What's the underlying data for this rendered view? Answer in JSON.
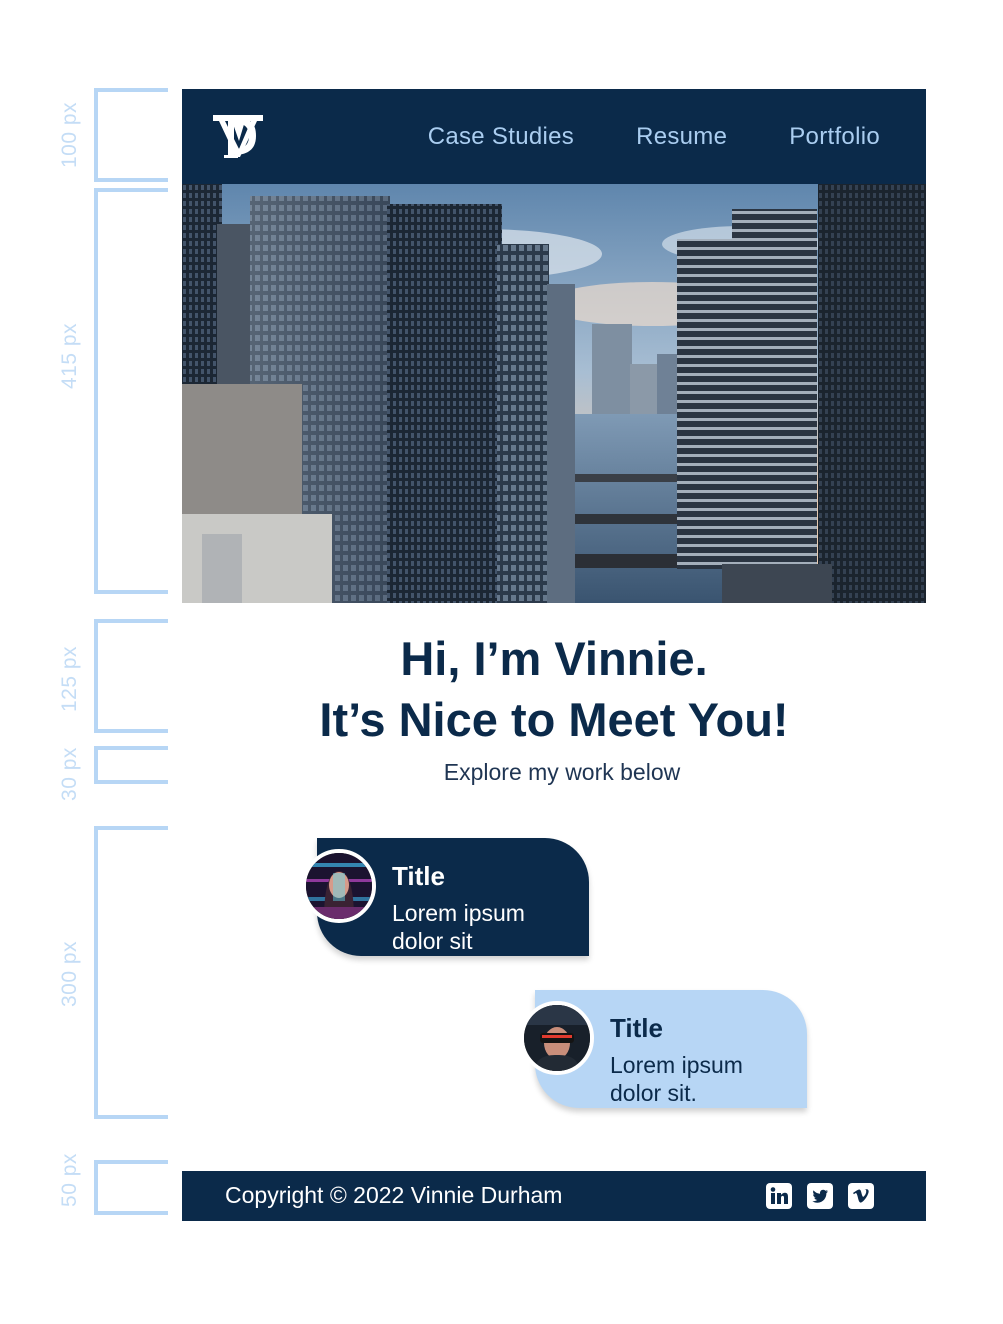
{
  "annotations": [
    {
      "label": "100 px"
    },
    {
      "label": "415 px"
    },
    {
      "label": "125 px"
    },
    {
      "label": "30 px"
    },
    {
      "label": "300 px"
    },
    {
      "label": "50 px"
    }
  ],
  "header": {
    "logo_icon": "vd-monogram-logo",
    "nav": [
      "Case Studies",
      "Resume",
      "Portfolio"
    ]
  },
  "hero": {
    "image": "city-skyline-river-photo"
  },
  "intro": {
    "headline_line1": "Hi, I’m Vinnie.",
    "headline_line2": "It’s Nice to Meet You!",
    "subline": "Explore my work below"
  },
  "cards": [
    {
      "title": "Title",
      "line1": "Lorem ipsum",
      "line2": "dolor sit",
      "avatar": "woman-glitch-portrait-avatar"
    },
    {
      "title": "Title",
      "line1": "Lorem ipsum",
      "line2": "dolor sit.",
      "avatar": "man-vr-headset-avatar"
    }
  ],
  "footer": {
    "copyright": "Copyright © 2022 Vinnie Durham",
    "social_icons": [
      "linkedin-icon",
      "twitter-icon",
      "vimeo-icon"
    ]
  },
  "colors": {
    "navy": "#0b2a4a",
    "light_blue": "#b7d6f5",
    "nav_text": "#aacdf0",
    "annotation": "#c4ddf6"
  }
}
